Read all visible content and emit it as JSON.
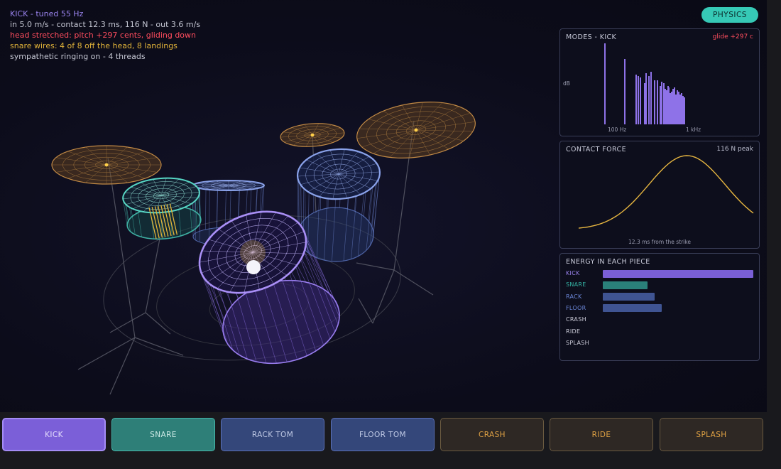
{
  "info": {
    "line1": "KICK  -  tuned 55 Hz",
    "line2": "in 5.0 m/s  -  contact 12.3 ms, 116 N  -  out 3.6 m/s",
    "line3": "head stretched: pitch +297 cents, gliding down",
    "line4": "snare wires: 4 of 8 off the head, 8 landings",
    "line5": "sympathetic ringing on  -  4 threads"
  },
  "physics_button": "PHYSICS",
  "modes": {
    "title": "MODES - KICK",
    "glide": "glide +297 c",
    "ylabel": "dB",
    "tick_100": "100 Hz",
    "tick_1k": "1 kHz"
  },
  "contact": {
    "title": "CONTACT FORCE",
    "peak": "116 N peak",
    "xlabel": "12.3 ms from the strike"
  },
  "energy": {
    "title": "ENERGY IN EACH PIECE",
    "items": [
      {
        "label": "KICK",
        "fraction": 1.0,
        "color": "#7a5fd6",
        "text_color": "#9b84f0"
      },
      {
        "label": "SNARE",
        "fraction": 0.295,
        "color": "#2a807a",
        "text_color": "#34b3a4"
      },
      {
        "label": "RACK",
        "fraction": 0.345,
        "color": "#3f5492",
        "text_color": "#6b86d8"
      },
      {
        "label": "FLOOR",
        "fraction": 0.39,
        "color": "#3f5492",
        "text_color": "#6b86d8"
      },
      {
        "label": "CRASH",
        "fraction": 0,
        "color": "#6b5a3c",
        "text_color": "#c9c9d6"
      },
      {
        "label": "RIDE",
        "fraction": 0,
        "color": "#6b5a3c",
        "text_color": "#c9c9d6"
      },
      {
        "label": "SPLASH",
        "fraction": 0,
        "color": "#6b5a3c",
        "text_color": "#c9c9d6"
      }
    ]
  },
  "buttons": [
    "KICK",
    "SNARE",
    "RACK TOM",
    "FLOOR TOM",
    "CRASH",
    "RIDE",
    "SPLASH"
  ],
  "colors": {
    "kick": "#7b5fd8",
    "snare": "#2e7f78",
    "tom": "#34477a",
    "cymbal": "#2e2824",
    "cymbal_text": "#e0a244",
    "accent_teal": "#36c9b6",
    "alert_red": "#ff4d5e",
    "snare_yellow": "#e2b43a"
  }
}
